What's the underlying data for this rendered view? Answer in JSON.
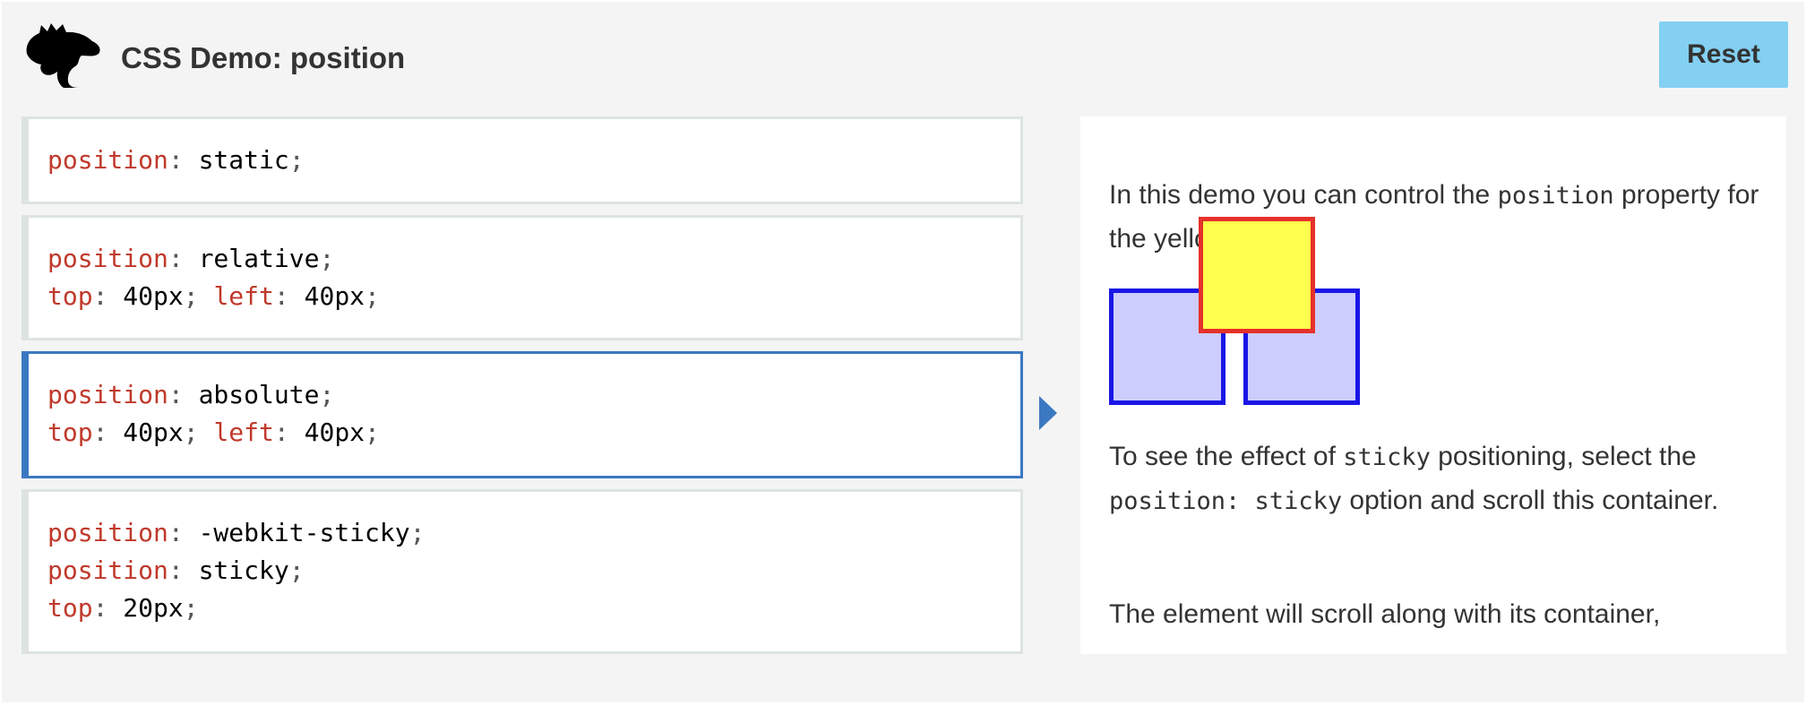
{
  "header": {
    "title": "CSS Demo: position",
    "reset_label": "Reset"
  },
  "options": [
    {
      "lines": [
        [
          [
            "prop",
            "position"
          ],
          [
            "punc",
            ": "
          ],
          [
            "val",
            "static"
          ],
          [
            "punc",
            ";"
          ]
        ]
      ]
    },
    {
      "lines": [
        [
          [
            "prop",
            "position"
          ],
          [
            "punc",
            ": "
          ],
          [
            "val",
            "relative"
          ],
          [
            "punc",
            ";"
          ]
        ],
        [
          [
            "prop",
            "top"
          ],
          [
            "punc",
            ": "
          ],
          [
            "val",
            "40px"
          ],
          [
            "punc",
            "; "
          ],
          [
            "prop",
            "left"
          ],
          [
            "punc",
            ": "
          ],
          [
            "val",
            "40px"
          ],
          [
            "punc",
            ";"
          ]
        ]
      ]
    },
    {
      "lines": [
        [
          [
            "prop",
            "position"
          ],
          [
            "punc",
            ": "
          ],
          [
            "val",
            "absolute"
          ],
          [
            "punc",
            ";"
          ]
        ],
        [
          [
            "prop",
            "top"
          ],
          [
            "punc",
            ": "
          ],
          [
            "val",
            "40px"
          ],
          [
            "punc",
            "; "
          ],
          [
            "prop",
            "left"
          ],
          [
            "punc",
            ": "
          ],
          [
            "val",
            "40px"
          ],
          [
            "punc",
            ";"
          ]
        ]
      ],
      "selected": true
    },
    {
      "lines": [
        [
          [
            "prop",
            "position"
          ],
          [
            "punc",
            ": "
          ],
          [
            "val",
            "-webkit-sticky"
          ],
          [
            "punc",
            ";"
          ]
        ],
        [
          [
            "prop",
            "position"
          ],
          [
            "punc",
            ": "
          ],
          [
            "val",
            "sticky"
          ],
          [
            "punc",
            ";"
          ]
        ],
        [
          [
            "prop",
            "top"
          ],
          [
            "punc",
            ": "
          ],
          [
            "val",
            "20px"
          ],
          [
            "punc",
            ";"
          ]
        ]
      ]
    }
  ],
  "output": {
    "para1_a": "In this demo you can control the ",
    "para1_code": "position",
    "para1_b": " property for the yellow box.",
    "para2_a": "To see the effect of ",
    "para2_code1": "sticky",
    "para2_b": " positioning, select the ",
    "para2_code2": "position: sticky",
    "para2_c": " option and scroll this container.",
    "para3": "The element will scroll along with its container,"
  },
  "colors": {
    "accent": "#3b78c2",
    "reset_bg": "#83d0f2",
    "property": "#c0392b",
    "blue_box_fill": "#cdcdfd",
    "blue_box_border": "#1a16e6",
    "yellow_box_fill": "#ffff4f",
    "yellow_box_border": "#e6312a"
  },
  "icons": {
    "logo": "dinosaur-head-logo",
    "selected_indicator": "triangle-right-icon"
  }
}
